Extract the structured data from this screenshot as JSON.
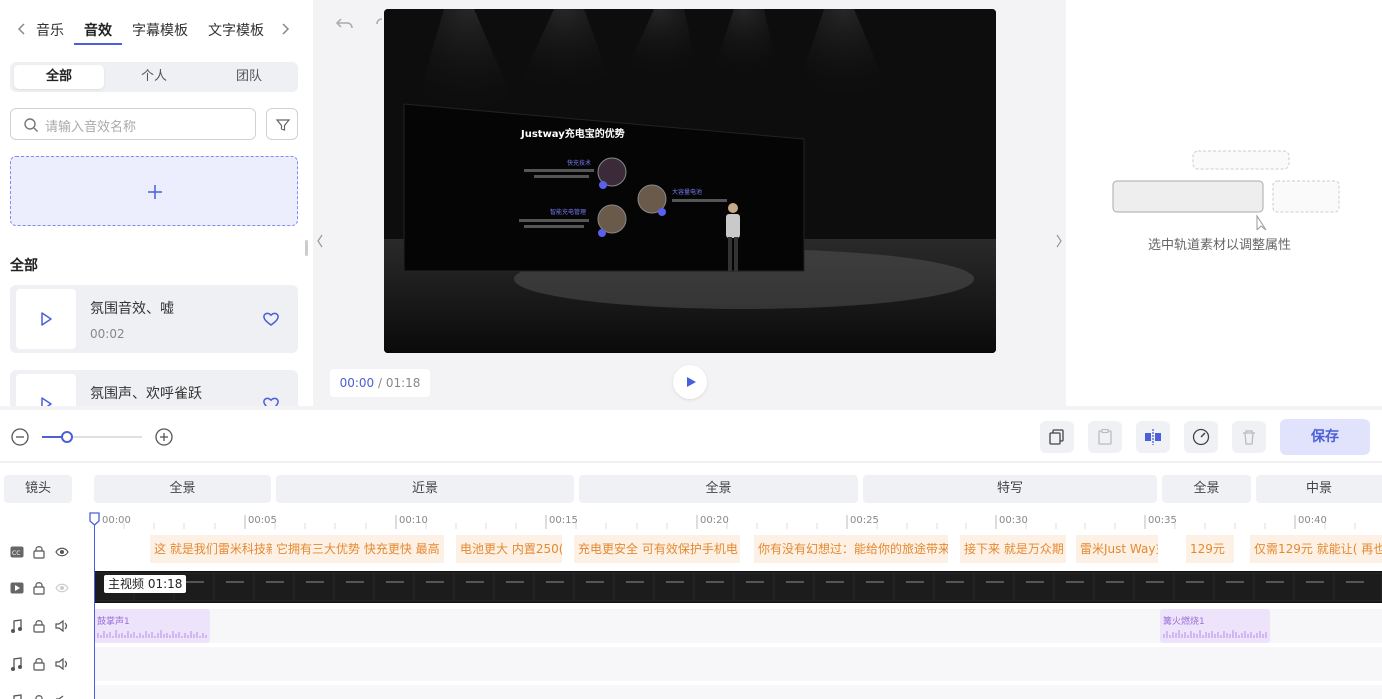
{
  "left_panel": {
    "tabs": [
      "音乐",
      "音效",
      "字幕模板",
      "文字模板"
    ],
    "active_tab": "音效",
    "segments": [
      "全部",
      "个人",
      "团队"
    ],
    "active_segment": "全部",
    "search_placeholder": "请输入音效名称",
    "section_title": "全部",
    "items": [
      {
        "title": "氛围音效、嘘",
        "duration": "00:02"
      },
      {
        "title": "氛围声、欢呼雀跃",
        "duration": ""
      }
    ]
  },
  "preview": {
    "current_time": "00:00",
    "total_time": "/ 01:18",
    "slide_title": "Justway充电宝的优势",
    "features": [
      "快充技术",
      "大容量电池",
      "智能充电管理"
    ]
  },
  "properties": {
    "hint": "选中轨道素材以调整属性"
  },
  "toolbar": {
    "save_label": "保存",
    "accent": "#4a5fd9"
  },
  "timeline": {
    "shot_label": "镜头",
    "shots": [
      "全景",
      "近景",
      "全景",
      "特写",
      "全景",
      "中景"
    ],
    "ticks": [
      "00:00",
      "00:05",
      "00:10",
      "00:15",
      "00:20",
      "00:25",
      "00:30",
      "00:35",
      "00:40"
    ],
    "subtitles": [
      "这 就是我们雷米科技新",
      "它拥有三大优势 快充更快 最高",
      "电池更大 内置250(",
      "充电更安全 可有效保护手机电",
      "你有没有幻想过：能给你的旅途带来",
      "接下来 就是万众期",
      "雷米Just Way充",
      "129元",
      "仅需129元 就能让( 再也"
    ],
    "main_video_label": "主视频 01:18",
    "audio_clips": [
      "鼓掌声1",
      "篝火燃烧1"
    ]
  }
}
